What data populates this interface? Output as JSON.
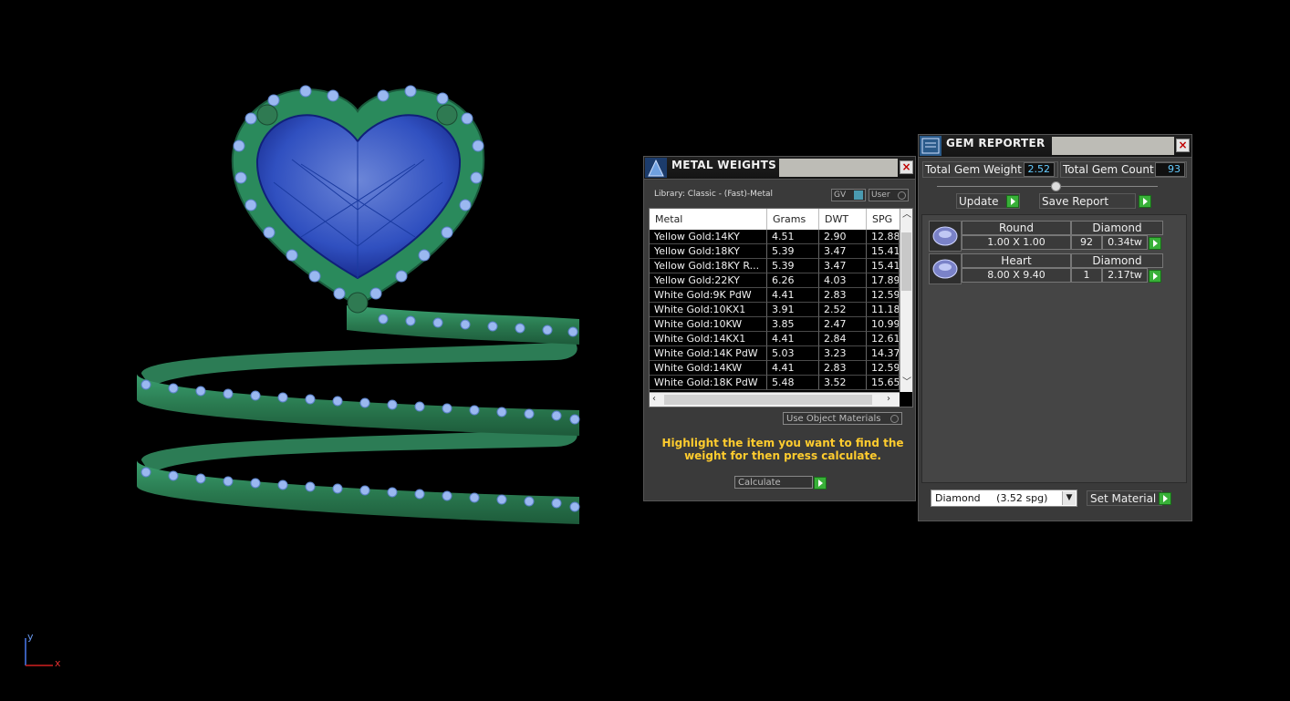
{
  "viewport": {
    "axis_y": "y",
    "axis_x": "x",
    "ring_colors": {
      "band": "#2f8f5f",
      "stone": "#3050c0",
      "pave": "#9ab8f0"
    }
  },
  "metal_weights": {
    "title": "METAL WEIGHTS",
    "library": "Library: Classic - (Fast)-Metal",
    "gv_label": "GV",
    "user_label": "User",
    "columns": [
      "Metal",
      "Grams",
      "DWT",
      "SPG"
    ],
    "rows": [
      [
        "Yellow Gold:14KY",
        "4.51",
        "2.90",
        "12.88"
      ],
      [
        "Yellow Gold:18KY",
        "5.39",
        "3.47",
        "15.41"
      ],
      [
        "Yellow Gold:18KY R...",
        "5.39",
        "3.47",
        "15.41"
      ],
      [
        "Yellow Gold:22KY",
        "6.26",
        "4.03",
        "17.89"
      ],
      [
        "White Gold:9K PdW",
        "4.41",
        "2.83",
        "12.59"
      ],
      [
        "White Gold:10KX1",
        "3.91",
        "2.52",
        "11.18"
      ],
      [
        "White Gold:10KW",
        "3.85",
        "2.47",
        "10.99"
      ],
      [
        "White Gold:14KX1",
        "4.41",
        "2.84",
        "12.61"
      ],
      [
        "White Gold:14K PdW",
        "5.03",
        "3.23",
        "14.37"
      ],
      [
        "White Gold:14KW",
        "4.41",
        "2.83",
        "12.59"
      ],
      [
        "White Gold:18K PdW",
        "5.48",
        "3.52",
        "15.65"
      ]
    ],
    "use_object_materials": "Use Object Materials",
    "hint": "Highlight the item you want to find the weight for then press calculate.",
    "calculate_label": "Calculate"
  },
  "gem_reporter": {
    "title": "GEM REPORTER",
    "total_weight_label": "Total Gem Weight",
    "total_weight_value": "2.52",
    "total_count_label": "Total Gem Count",
    "total_count_value": "93",
    "update_label": "Update",
    "save_report_label": "Save Report",
    "gems": [
      {
        "shape": "Round",
        "material": "Diamond",
        "size": "1.00 X 1.00",
        "count": "92",
        "weight": "0.34tw"
      },
      {
        "shape": "Heart",
        "material": "Diamond",
        "size": "8.00 X 9.40",
        "count": "1",
        "weight": "2.17tw"
      }
    ],
    "material_select": "Diamond     (3.52 spg)",
    "set_material_label": "Set Material"
  },
  "icons": [
    "close-icon",
    "play-icon",
    "dropdown-arrow-icon",
    "scroll-up-icon",
    "scroll-down-icon",
    "scroll-left-icon",
    "scroll-right-icon",
    "gem-icon"
  ],
  "colors": {
    "hint_text": "#ffcc2e",
    "field_value": "#66ccff",
    "play_button": "#38b038",
    "close_x": "#c00000"
  }
}
